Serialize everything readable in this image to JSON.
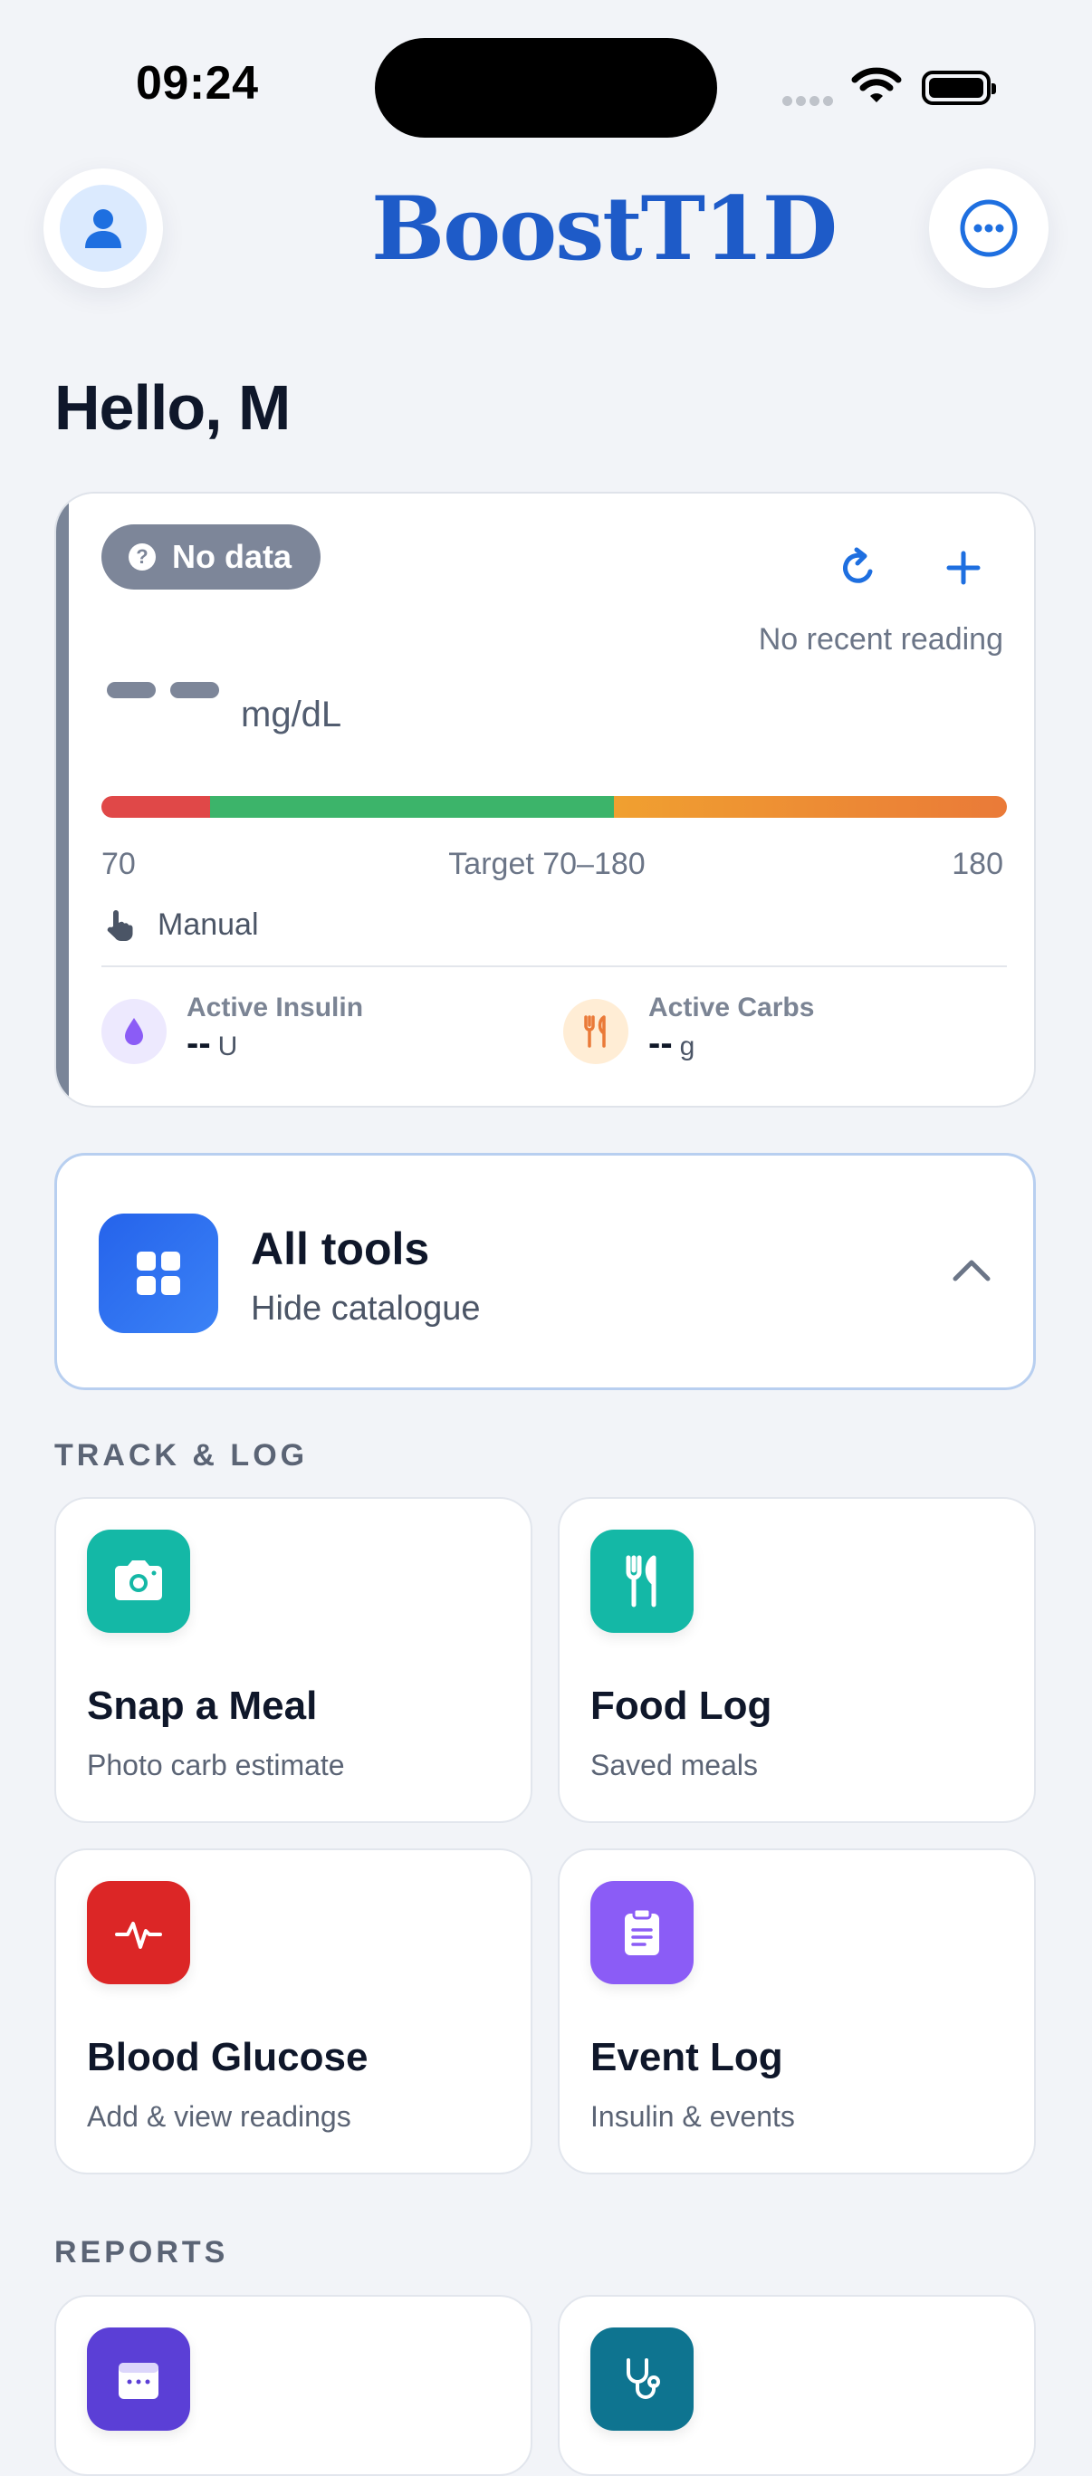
{
  "status_bar": {
    "time": "09:24"
  },
  "header": {
    "logo_text": "BoostT1D",
    "avatar_icon": "person-icon",
    "menu_icon": "more-horizontal-icon"
  },
  "greeting": "Hello, M",
  "glucose": {
    "badge": "No data",
    "badge_icon": "question-icon",
    "refresh_icon": "refresh-icon",
    "add_icon": "plus-icon",
    "status": "No recent reading",
    "unit": "mg/dL",
    "range_low_label": "70",
    "range_target_label": "Target 70–180",
    "range_high_label": "180",
    "source": "Manual",
    "active_insulin": {
      "label": "Active Insulin",
      "value": "--",
      "unit": "U"
    },
    "active_carbs": {
      "label": "Active Carbs",
      "value": "--",
      "unit": "g"
    },
    "colors": {
      "low": "#e04848",
      "in_range": "#3cb46a",
      "high": "#ea7a38"
    }
  },
  "all_tools": {
    "title": "All tools",
    "subtitle": "Hide catalogue"
  },
  "sections": {
    "track_log": "TRACK & LOG",
    "reports": "REPORTS"
  },
  "tiles": [
    {
      "title": "Snap a Meal",
      "subtitle": "Photo carb estimate",
      "icon": "camera-icon",
      "color": "#14b8a6"
    },
    {
      "title": "Food Log",
      "subtitle": "Saved meals",
      "icon": "utensils-icon",
      "color": "#14b8a6"
    },
    {
      "title": "Blood Glucose",
      "subtitle": "Add & view readings",
      "icon": "pulse-icon",
      "color": "#dc2626"
    },
    {
      "title": "Event Log",
      "subtitle": "Insulin & events",
      "icon": "clipboard-icon",
      "color": "#8b5cf6"
    }
  ]
}
